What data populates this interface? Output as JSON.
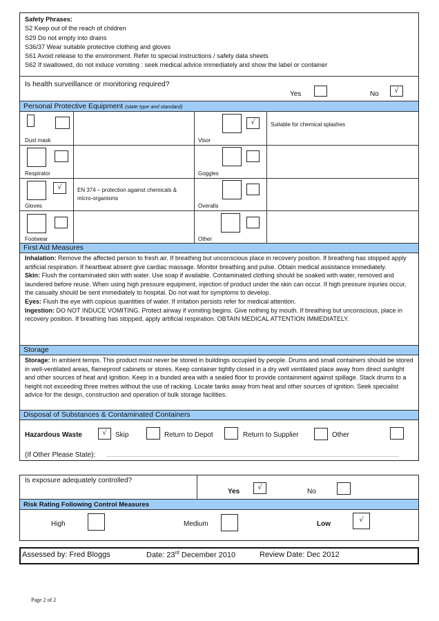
{
  "safety_phrases": {
    "heading": "Safety Phrases:",
    "items": [
      "S2 Keep out of the reach of children",
      "S29 Do not empty into drains",
      "S36/37 Wear suitable protective clothing and gloves",
      "S61 Avoid release to the environment. Refer to special instructions / safety data sheets",
      "S62 If swallowed, do not induce vomiting : seek medical advice immediately and show the label or container"
    ]
  },
  "health_surveillance": {
    "question": "Is health surveillance or monitoring required?",
    "yes_label": "Yes",
    "no_label": "No",
    "yes_checked": false,
    "no_checked": true,
    "check_glyph": "√"
  },
  "ppe": {
    "heading": "Personal Protective Equipment",
    "heading_note": "(state type and standard)",
    "rows": [
      {
        "left": {
          "label": "Dust mask",
          "checked": false,
          "note": ""
        },
        "right": {
          "label": "Visor",
          "checked": true,
          "note": "Suitable for chemical splashes"
        }
      },
      {
        "left": {
          "label": "Respirator",
          "checked": false,
          "note": ""
        },
        "right": {
          "label": "Goggles",
          "checked": false,
          "note": ""
        }
      },
      {
        "left": {
          "label": "Gloves",
          "checked": true,
          "note": "EN 374 – protection against chemicals & micro-organisms"
        },
        "right": {
          "label": "Overalls",
          "checked": false,
          "note": ""
        }
      },
      {
        "left": {
          "label": "Footwear",
          "checked": false,
          "note": ""
        },
        "right": {
          "label": "Other",
          "checked": false,
          "note": ""
        }
      }
    ]
  },
  "first_aid": {
    "heading": "First Aid Measures",
    "items": [
      {
        "label": "Inhalation:",
        "text": " Remove the affected person to fresh air. If breathing but unconscious place in recovery position. If breathing has stopped apply artificial respiration. If heartbeat absent give cardiac massage. Monitor breathing and pulse. Obtain medical assistance immediately."
      },
      {
        "label": "Skin:",
        "text": " Flush the contaminated skin with water. Use soap if available. Contaminated clothing should be soaked with water, removed and laundered before reuse. When using high pressure equipment, injection of product under the skin can occur. If high pressure injuries occur, the casualty should be sent immediately to hospital. Do not wait for symptoms to develop."
      },
      {
        "label": "Eyes:",
        "text": " Flush the eye with copious quantities of water. If irritation persists refer for medical attention."
      },
      {
        "label": "Ingestion:",
        "text": " DO NOT INDUCE VOMITING. Protect airway if vomiting begins. Give nothing by mouth. If breathing but unconscious, place in recovery position. If breathing has stopped, apply artificial respiration. OBTAIN MEDICAL ATTENTION IMMEDIATELY."
      }
    ]
  },
  "storage": {
    "heading": "Storage",
    "label": "Storage:",
    "text": " In ambient temps. This product must never be stored in buildings occupied by people. Drums and small containers should be stored in well-ventilated areas, flameproof cabinets or stores. Keep container tightly closed in a dry well ventilated place away from direct sunlight and other sources of heat and ignition. Keep in a bunded area with a sealed floor to provide containment against spillage. Stack drums to a height not exceeding three metres without the use of racking. Locate tanks away from heat and other sources of ignition. Seek specialist advice for the design, construction and operation of bulk storage facilities."
  },
  "disposal": {
    "heading": "Disposal of Substances & Contaminated Containers",
    "hazardous_label": "Hazardous Waste",
    "options": [
      {
        "label": "Skip",
        "checked": true
      },
      {
        "label": "Return to Depot",
        "checked": false
      },
      {
        "label": "Return to Supplier",
        "checked": false
      },
      {
        "label": "Other",
        "checked": false
      }
    ],
    "other_state_label": "(If Other Please State):",
    "other_state_value": ""
  },
  "exposure": {
    "question": "Is exposure adequately controlled?",
    "yes_label": "Yes",
    "no_label": "No",
    "yes_checked": true,
    "no_checked": false
  },
  "risk_rating": {
    "heading": "Risk Rating Following Control Measures",
    "options": [
      {
        "label": "High",
        "checked": false
      },
      {
        "label": "Medium",
        "checked": false
      },
      {
        "label": "Low",
        "checked": true
      }
    ]
  },
  "footer_info": {
    "assessed_by": "Assessed by: Fred Bloggs",
    "date_prefix": "Date: 23",
    "date_sup": "rd",
    "date_suffix": " December 2010",
    "review_date": "Review Date: Dec 2012"
  },
  "page_number": "Page 2 of 2"
}
